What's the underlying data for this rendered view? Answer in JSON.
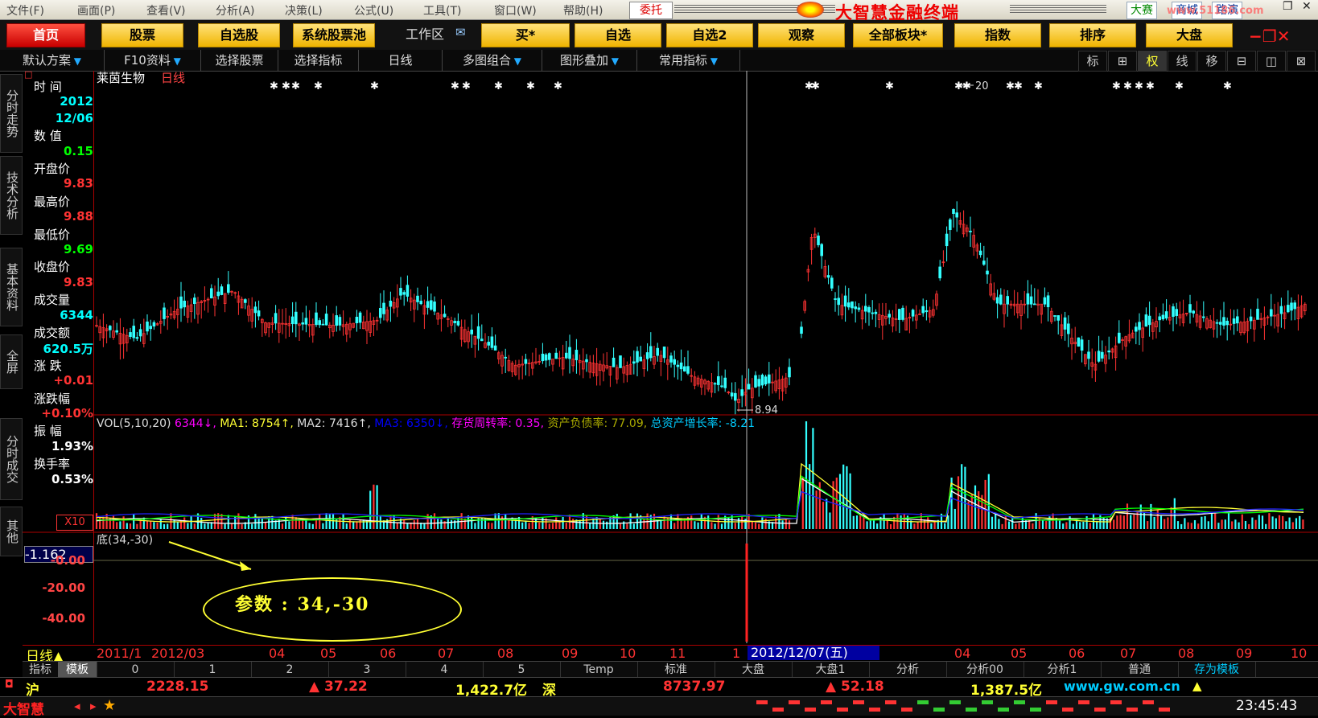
{
  "menu": [
    "文件(F)",
    "画面(P)",
    "查看(V)",
    "分析(A)",
    "决策(L)",
    "公式(U)",
    "工具(T)",
    "窗口(W)",
    "帮助(H)"
  ],
  "brand": {
    "weituo": "委托",
    "title": "大智慧金融终端",
    "tabs": [
      "大赛",
      "商城",
      "路演"
    ],
    "url_watermark": "www.51186.com"
  },
  "nav": {
    "home": "首页",
    "buttons": [
      "股票",
      "自选股",
      "系统股票池",
      "工作区",
      "买*",
      "自选",
      "自选2",
      "观察",
      "全部板块*",
      "指数",
      "排序",
      "大盘"
    ],
    "window_controls": "−❐✕"
  },
  "toolbar": {
    "items": [
      "默认方案",
      "F10资料",
      "选择股票",
      "选择指标",
      "日线",
      "多图组合",
      "图形叠加",
      "常用指标"
    ],
    "right": [
      "标",
      "⊞",
      "权",
      "线",
      "移",
      "⊟",
      "◫",
      "⊠"
    ]
  },
  "side_tabs": [
    "分时走势",
    "技术分析",
    "基本资料",
    "全屏",
    "分时成交",
    "其他"
  ],
  "panel": {
    "rows": [
      {
        "label": "时  间",
        "value": ""
      },
      {
        "label": "",
        "value": "2012"
      },
      {
        "label": "",
        "value": "12/06"
      },
      {
        "label": "数  值",
        "value": ""
      },
      {
        "label": "",
        "value": "0.15"
      },
      {
        "label": "开盘价",
        "value": ""
      },
      {
        "label": "",
        "value": "9.83"
      },
      {
        "label": "最高价",
        "value": ""
      },
      {
        "label": "",
        "value": "9.88"
      },
      {
        "label": "最低价",
        "value": ""
      },
      {
        "label": "",
        "value": "9.69"
      },
      {
        "label": "收盘价",
        "value": ""
      },
      {
        "label": "",
        "value": "9.83"
      },
      {
        "label": "成交量",
        "value": ""
      },
      {
        "label": "",
        "value": "6344"
      },
      {
        "label": "成交额",
        "value": ""
      },
      {
        "label": "",
        "value": "620.5万"
      },
      {
        "label": "涨  跌",
        "value": ""
      },
      {
        "label": "",
        "value": "+0.01"
      },
      {
        "label": "涨跌幅",
        "value": ""
      },
      {
        "label": "",
        "value": "+0.10%"
      },
      {
        "label": "振  幅",
        "value": ""
      },
      {
        "label": "",
        "value": "1.93%"
      },
      {
        "label": "换手率",
        "value": ""
      },
      {
        "label": "",
        "value": "0.53%"
      }
    ],
    "value_colors": [
      "#0ff",
      "#0ff",
      "#0ff",
      "#0ff",
      "#0f0",
      "#0ff",
      "#f33",
      "#0ff",
      "#f33",
      "#0ff",
      "#0f0",
      "#0ff",
      "#f33",
      "#0ff",
      "#0ff",
      "#0ff",
      "#0ff",
      "#0ff",
      "#f33",
      "#0ff",
      "#f33",
      "#0ff",
      "#fff",
      "#0ff",
      "#fff"
    ],
    "vol_unit": "X10"
  },
  "chart": {
    "stock_name": "莱茵生物",
    "period": "日线",
    "low_label": "8.94",
    "high_label": "20",
    "vol_legend": [
      {
        "text": "VOL(5,10,20)",
        "color": "#ddd"
      },
      {
        "text": " 6344↓,",
        "color": "#f0f"
      },
      {
        "text": " MA1: 8754↑,",
        "color": "#ff3"
      },
      {
        "text": " MA2: 7416↑,",
        "color": "#ddd"
      },
      {
        "text": " MA3: 6350↓,",
        "color": "#00f"
      },
      {
        "text": " 存货周转率: 0.35,",
        "color": "#f0f"
      },
      {
        "text": " 资产负债率: 77.09,",
        "color": "#aa0"
      },
      {
        "text": " 总资产增长率: -8.21",
        "color": "#0cf"
      }
    ],
    "ind_legend": "底(34,-30)",
    "ind_current": "-1.162",
    "ind_yticks": [
      "-0.00",
      "-20.00",
      "-40.00"
    ],
    "annotation": "参数 : 34,-30"
  },
  "chart_data": {
    "type": "candlestick",
    "title": "",
    "xlabel": "",
    "ylabel": "",
    "x_ticks": [
      "2011/1",
      "2012/0",
      "03",
      "04",
      "05",
      "06",
      "07",
      "08",
      "09",
      "10",
      "11",
      "1",
      "04",
      "05",
      "06",
      "07",
      "08",
      "09",
      "10"
    ],
    "cursor_date": "2012/12/07(五)",
    "price_low": 8.94,
    "price_high": 20
  },
  "date_axis_label": "日线",
  "templates": [
    "指标",
    "模板",
    "0",
    "1",
    "2",
    "3",
    "4",
    "5",
    "Temp",
    "标准",
    "大盘",
    "大盘1",
    "分析",
    "分析00",
    "分析1",
    "普通",
    "存为模板"
  ],
  "status": {
    "sh_label": "沪",
    "sh_index": "2228.15",
    "sh_change": "▲ 37.22",
    "sh_amount": "1,422.7亿",
    "sz_label": "深",
    "sz_index": "8737.97",
    "sz_change": "▲ 52.18",
    "sz_amount": "1,387.5亿",
    "website": "www.gw.com.cn"
  },
  "bottom": {
    "logo": "大智慧",
    "time": "23:45:43"
  }
}
